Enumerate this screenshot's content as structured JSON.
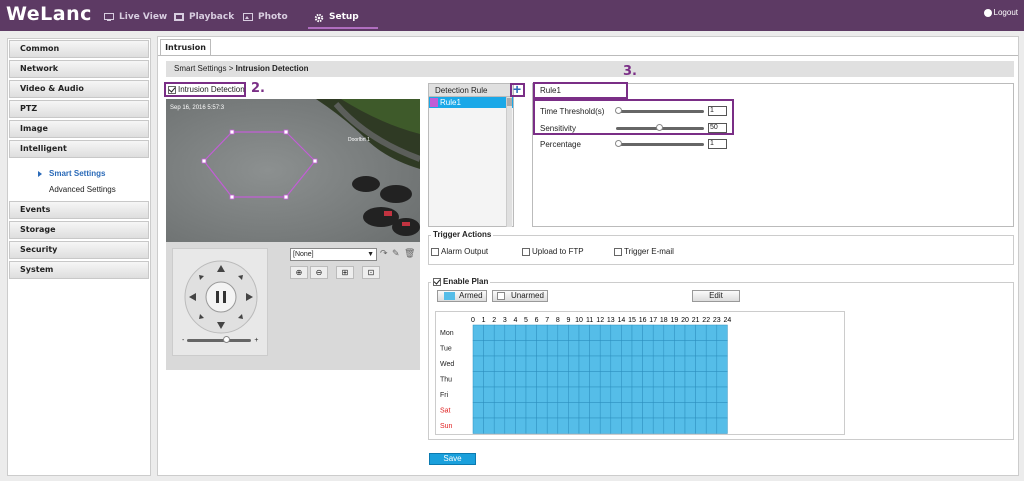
{
  "app": {
    "logo": "WeLanc",
    "nav": [
      {
        "label": "Live View",
        "icon": "monitor-icon"
      },
      {
        "label": "Playback",
        "icon": "film-icon"
      },
      {
        "label": "Photo",
        "icon": "photo-icon"
      },
      {
        "label": "Setup",
        "icon": "gear-icon",
        "active": true
      }
    ],
    "logout": "Logout"
  },
  "sidebar": {
    "items": [
      "Common",
      "Network",
      "Video & Audio",
      "PTZ",
      "Image",
      "Intelligent"
    ],
    "sub_items": [
      {
        "label": "Smart Settings",
        "active": true
      },
      {
        "label": "Advanced Settings"
      }
    ],
    "items_after": [
      "Events",
      "Storage",
      "Security",
      "System"
    ]
  },
  "main": {
    "tab": "Intrusion",
    "breadcrumb_parent": "Smart Settings",
    "breadcrumb_sep": ">",
    "breadcrumb_current": "Intrusion Detection",
    "intrusion_checkbox_label": "Intrusion Detection",
    "callout_2": "2.",
    "callout_3": "3."
  },
  "video": {
    "timestamp": "Sep 16, 2016  5:57:3",
    "caption": "Doorlbrt 1"
  },
  "ptz": {
    "preset_value": "[None]",
    "slider_minus": "-",
    "slider_plus": "+",
    "slider_level": 0.6
  },
  "rules": {
    "header": "Detection Rule",
    "add_symbol": "+",
    "items": [
      "Rule1"
    ],
    "selected_name": "Rule1"
  },
  "params": {
    "time_threshold_label": "Time Threshold(s)",
    "time_threshold_value": "1",
    "sensitivity_label": "Sensitivity",
    "sensitivity_value": "50",
    "percentage_label": "Percentage",
    "percentage_value": "1"
  },
  "trigger": {
    "title": "Trigger Actions",
    "options": [
      "Alarm Output",
      "Upload to FTP",
      "Trigger E-mail"
    ]
  },
  "plan": {
    "enable_label": "Enable Plan",
    "armed": "Armed",
    "unarmed": "Unarmed",
    "edit": "Edit",
    "hours": [
      "0",
      "1",
      "2",
      "3",
      "4",
      "5",
      "6",
      "7",
      "8",
      "9",
      "10",
      "11",
      "12",
      "13",
      "14",
      "15",
      "16",
      "17",
      "18",
      "19",
      "20",
      "21",
      "22",
      "23",
      "24"
    ],
    "days": [
      "Mon",
      "Tue",
      "Wed",
      "Thu",
      "Fri",
      "Sat",
      "Sun"
    ],
    "armed_color": "#55bde8",
    "weekend_color": "#e02020"
  },
  "save_label": "Save",
  "colors": {
    "topbar": "#5d3a64",
    "accent": "#7a2e86",
    "selected_row": "#1aa8e8",
    "zone": "#c25ed6"
  }
}
